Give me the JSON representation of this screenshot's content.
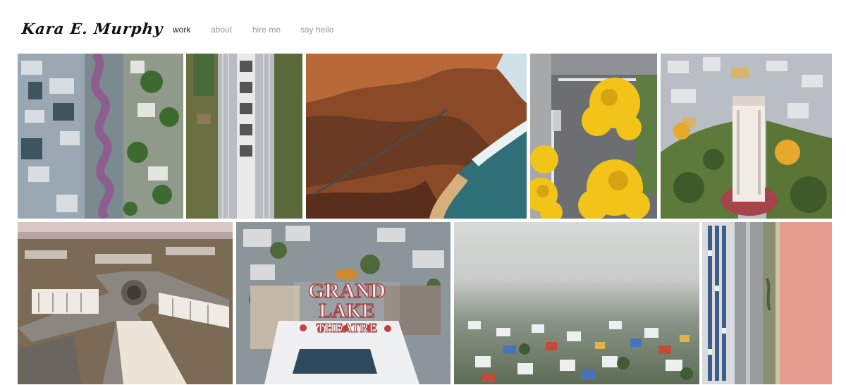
{
  "site": {
    "logo": "Kara E. Murphy"
  },
  "nav": [
    {
      "label": "work",
      "active": true
    },
    {
      "label": "about",
      "active": false
    },
    {
      "label": "hire me",
      "active": false
    },
    {
      "label": "say hello",
      "active": false
    }
  ],
  "gallery": {
    "sign": {
      "line1": "GRAND",
      "line2": "LAKE",
      "line3": "THEATRE"
    }
  },
  "colors": {
    "nav_active": "#222222",
    "nav_inactive": "#9a9a9a",
    "foliage_yellow": "#f2c318",
    "pink_salt_pond": "#e59c8f"
  }
}
